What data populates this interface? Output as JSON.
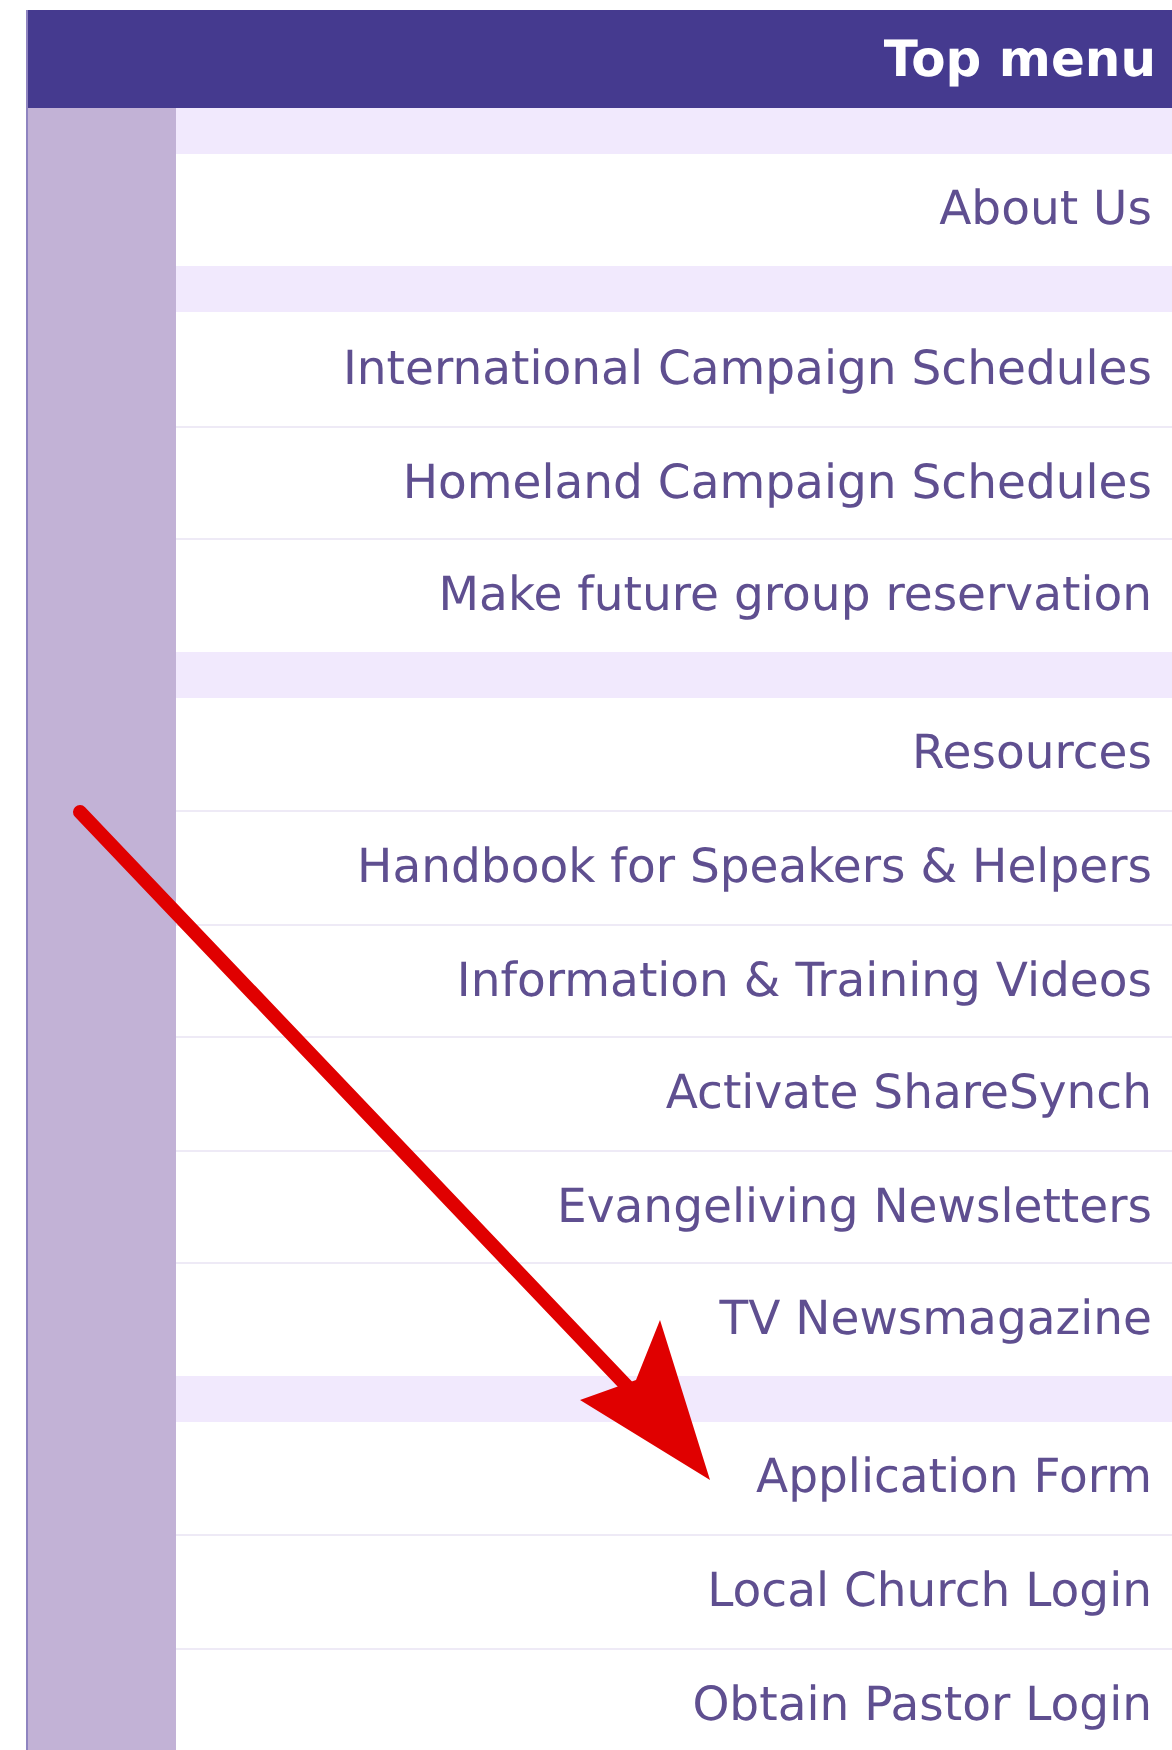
{
  "header": {
    "title": "Top menu"
  },
  "groups": [
    {
      "items": [
        "About Us"
      ]
    },
    {
      "items": [
        "International Campaign Schedules",
        "Homeland Campaign Schedules",
        "Make future group reservation"
      ]
    },
    {
      "items": [
        "Resources",
        "Handbook for Speakers & Helpers",
        "Information & Training Videos",
        "Activate ShareSynch",
        "Evangeliving Newsletters",
        "TV Newsmagazine"
      ]
    },
    {
      "items": [
        "Application Form",
        "Local Church Login",
        "Obtain Pastor Login"
      ]
    }
  ]
}
